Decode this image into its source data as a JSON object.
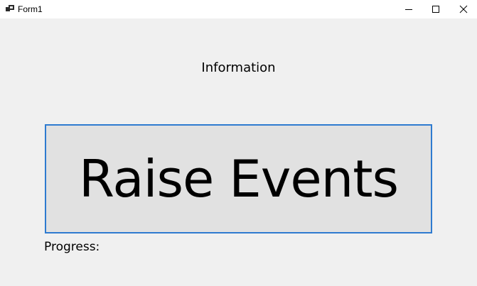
{
  "window": {
    "title": "Form1",
    "icon": "form-icon",
    "controls": {
      "minimize_icon": "minimize-icon",
      "maximize_icon": "maximize-icon",
      "close_icon": "close-icon"
    }
  },
  "form": {
    "info_label": "Information",
    "raise_button_label": "Raise Events",
    "progress_label": "Progress:"
  },
  "colors": {
    "client_background": "#f0f0f0",
    "button_background": "#e1e1e1",
    "button_focus_border": "#2e7bd0"
  }
}
